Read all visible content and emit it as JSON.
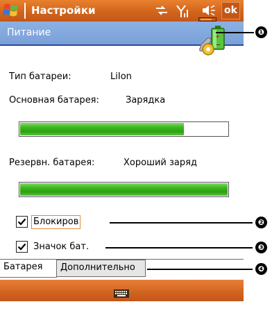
{
  "window": {
    "title": "Настройки",
    "ok_label": "ok",
    "status_icons": [
      "windows-start-icon",
      "sync-icon",
      "signal-icon",
      "volume-icon",
      "battery-icon"
    ]
  },
  "section": {
    "title": "Питание",
    "icon": "power-settings-icon"
  },
  "battery": {
    "type_label": "Тип батареи:",
    "type_value": "LiIon",
    "main_label": "Основная батарея:",
    "main_status": "Зарядка",
    "main_level": 0.79,
    "backup_label": "Резервн. батарея:",
    "backup_status": "Хороший заряд",
    "backup_level": 1.0
  },
  "options": {
    "lock_label": "Блокиров",
    "lock_checked": true,
    "icon_label": "Значок бат.",
    "icon_checked": true
  },
  "tabs": [
    {
      "label": "Батарея",
      "active": true
    },
    {
      "label": "Дополнительно",
      "active": false
    }
  ],
  "callouts": [
    "❶",
    "❷",
    "❸",
    "❹"
  ],
  "colors": {
    "titlebar": "#d2651b",
    "section_header": "#7aa0d8",
    "bar_fill": "#3cb81e"
  }
}
